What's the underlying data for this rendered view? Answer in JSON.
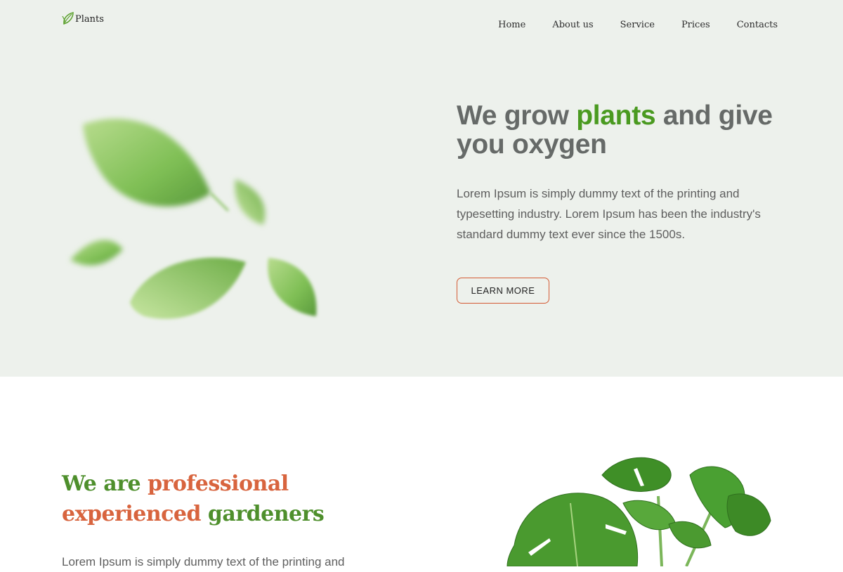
{
  "header": {
    "logo_text": "Plants",
    "nav": [
      {
        "label": "Home"
      },
      {
        "label": "About us"
      },
      {
        "label": "Service"
      },
      {
        "label": "Prices"
      },
      {
        "label": "Contacts"
      }
    ]
  },
  "hero": {
    "title_part1": "We grow ",
    "title_accent": "plants",
    "title_part2": " and give you oxygen",
    "description": "Lorem Ipsum is simply dummy text of the printing and typesetting industry. Lorem Ipsum has been the industry's standard dummy text ever since the 1500s.",
    "button_label": "LEARN MORE"
  },
  "about": {
    "title_w1": "We are ",
    "title_w2": "professional",
    "title_w3": "experienced",
    "title_w4": " gardeners",
    "description": "Lorem Ipsum is simply dummy text of the printing and"
  },
  "colors": {
    "hero_bg": "#edf1ec",
    "accent_green": "#4a9a20",
    "accent_orange": "#d8643e",
    "button_border": "#d45a33"
  },
  "icons": {
    "logo": "leaf-icon",
    "hero_image": "falling-leaves-image",
    "plant_image": "monstera-plant-image"
  }
}
